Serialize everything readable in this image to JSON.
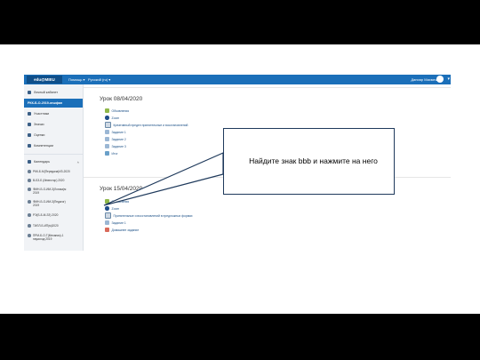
{
  "topbar": {
    "logo": "edu@MIEU",
    "menu1": "Помощь ▾",
    "menu2": "Русский (ru) ▾",
    "user": "Данияр Махмеш"
  },
  "sidebar": {
    "items": [
      {
        "label": "Личный кабинет",
        "active": false
      },
      {
        "label": "РКК-Б-О-2019-кешфан",
        "active": true
      },
      {
        "label": "Участники",
        "active": false
      },
      {
        "label": "Значки",
        "active": false
      },
      {
        "label": "Оценки",
        "active": false
      },
      {
        "label": "Компетенции",
        "active": false
      }
    ],
    "courses_header": "Календарь",
    "courses": [
      "РКК-Б-М(Передача)ИЗ-2020",
      "В-БЗ-Б (Инвестор) 2020",
      "ФМН-Б-О-ИМ-3(Логика)м 2019",
      "ФМН-Б-О-ИМ-3(Педагог) 2019",
      "РЭ(Б-Б-М-ЗЗ) 2020",
      "ТИЛЛ-Б-ИП(м)2020",
      "ПРМ-Б-О-Т(Механик)-1 наукоход 2019"
    ]
  },
  "sections": [
    {
      "title": "Урок 08/04/2020",
      "activities": [
        {
          "icon": "forum",
          "label": "Объявления"
        },
        {
          "icon": "zoom",
          "label": "Zoom"
        },
        {
          "icon": "pdf",
          "label": "Креативный предел принятельные и восстановлений"
        },
        {
          "icon": "quiz",
          "label": "Задание 1"
        },
        {
          "icon": "quiz",
          "label": "Задание 2"
        },
        {
          "icon": "quiz",
          "label": "Задание 3"
        },
        {
          "icon": "stats",
          "label": "Итог"
        }
      ]
    },
    {
      "title": "Урок 15/04/2020",
      "activities": [
        {
          "icon": "forum",
          "label": "Объявления"
        },
        {
          "icon": "zoom",
          "label": "Zoom"
        },
        {
          "icon": "pdf",
          "label": "Принятельные и восстановлений в предложных формах"
        },
        {
          "icon": "quiz",
          "label": "Задание 1"
        },
        {
          "icon": "assign",
          "label": "Домашнее задание"
        }
      ]
    }
  ],
  "callout": {
    "text": "Найдите знак bbb и нажмите на него"
  }
}
